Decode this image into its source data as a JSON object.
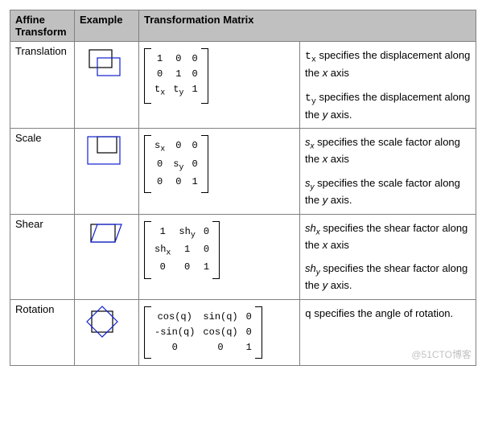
{
  "headers": {
    "c1": "Affine Transform",
    "c2": "Example",
    "c34": "Transformation Matrix"
  },
  "rows": [
    {
      "name": "Translation",
      "example": "translation",
      "matrix": [
        [
          "1",
          "0",
          "0"
        ],
        [
          "0",
          "1",
          "0"
        ],
        [
          "t<sub class=\"sub\">x</sub>",
          "t<sub class=\"sub\">y</sub>",
          "1"
        ]
      ],
      "desc": [
        "<span class=\"code\">t<sub class=\"sub\">x</sub></span> specifies the displacement along the <em class=\"var\">x</em> axis",
        "<span class=\"code\">t<sub class=\"sub\">y</sub></span> specifies the displacement along the <em class=\"var\">y</em> axis."
      ]
    },
    {
      "name": "Scale",
      "example": "scale",
      "matrix": [
        [
          "s<sub class=\"sub\">x</sub>",
          "0",
          "0"
        ],
        [
          "0",
          "s<sub class=\"sub\">y</sub>",
          "0"
        ],
        [
          "0",
          "0",
          "1"
        ]
      ],
      "desc": [
        "<em class=\"var\">s<sub class=\"sub\">x</sub></em> specifies the scale factor along the <em class=\"var\">x</em> axis",
        "<em class=\"var\">s<sub class=\"sub\">y</sub></em> specifies the scale factor along the <em class=\"var\">y</em> axis."
      ]
    },
    {
      "name": "Shear",
      "example": "shear",
      "matrix": [
        [
          "1",
          "sh<sub class=\"sub\">y</sub>",
          "0"
        ],
        [
          "sh<sub class=\"sub\">x</sub>",
          "1",
          "0"
        ],
        [
          "0",
          "0",
          "1"
        ]
      ],
      "desc": [
        "<em class=\"var\">sh<sub class=\"sub\">x</sub></em> specifies the shear factor along the <em class=\"var\">x</em> axis",
        "<em class=\"var\">sh<sub class=\"sub\">y</sub></em> specifies the shear factor along the <em class=\"var\">y</em> axis."
      ]
    },
    {
      "name": "Rotation",
      "example": "rotation",
      "matrix": [
        [
          "cos(q)",
          "sin(q)",
          "0"
        ],
        [
          "-sin(q)",
          "cos(q)",
          "0"
        ],
        [
          "0",
          "0",
          "1"
        ]
      ],
      "desc": [
        "<span class=\"code\">q</span> specifies the angle of rotation."
      ]
    }
  ],
  "watermark": "@51CTO博客"
}
